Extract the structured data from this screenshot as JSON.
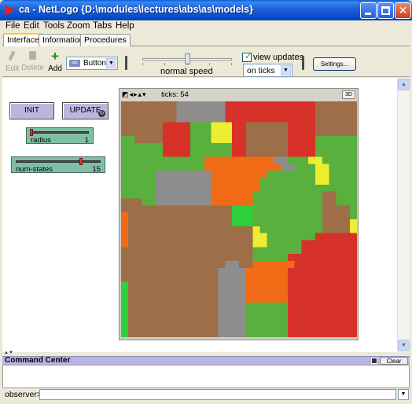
{
  "window": {
    "title": "ca - NetLogo {D:\\modules\\lectures\\abs\\as\\models}"
  },
  "menu": [
    "File",
    "Edit",
    "Tools",
    "Zoom",
    "Tabs",
    "Help"
  ],
  "tabs": [
    {
      "label": "Interface",
      "active": true
    },
    {
      "label": "Information",
      "active": false
    },
    {
      "label": "Procedures",
      "active": false
    }
  ],
  "toolbar": {
    "edit_label": "Edit",
    "delete_label": "Delete",
    "add_label": "Add",
    "widget_type": "Button",
    "speed_label": "normal speed",
    "speed_level": 0.5,
    "view_updates_label": "view updates",
    "view_updates_checked": true,
    "update_mode": "on ticks",
    "settings_label": "Settings..."
  },
  "widgets": {
    "init_button": "INIT",
    "update_button": "UPDATE",
    "radius_slider": {
      "name": "radius",
      "value": "1",
      "fraction": 0.0
    },
    "num_states_slider": {
      "name": "num-states",
      "value": "15",
      "fraction": 0.78
    }
  },
  "view": {
    "ticks_label": "ticks: 54",
    "btn_3d": "3D"
  },
  "command_center": {
    "title": "Command Center",
    "clear_label": "Clear",
    "prompt": "observer>"
  },
  "colors": {
    "brown": "#9D6E48",
    "gray": "#8D8D8D",
    "red": "#D73229",
    "green": "#59B03C",
    "orange": "#F16A15",
    "yellow": "#EDED31",
    "lime": "#2CD13B",
    "turquoise": "#1D9F78"
  },
  "world_grid": [
    "bbbbbbbbgggggggrrrrrrrrrrrrrbbbbbb",
    "bbbbbbbbgggggggrrrrrrrrrrrrrbbbbbb",
    "bbbbbbbbgggggggrrrrrrrrrrrrrbbbbbb",
    "bbbbbbrrrrGGGyyyrrbbbbbbrrrrbbbbbb",
    "bbbbbbrrrrGGGyyyrrbbbbbbrrrrbbbbbb",
    "GGbbbbrrrrGGGyyyrrbbbbbbrrrrGGGGGG",
    "GGGGGGrrrrGGGGGGrrbbbbbbrrrrGGGGGG",
    "GGGGGGrrrrGGGGGGrrbbbbbbrrrrGGGGGG",
    "GGGGGGGGGGGGooooooooooggGGGyyGGGGGG",
    "GGGGGGGGGGGGoooooooooooggGGGyyGGGGG",
    "GGGGGggggggggooooooooGGGGGGGyyGGGGG",
    "GGGGGggggggggoooooooGGGGGGGGyyGGGGG",
    "GGGGGggggggggoooooooGGGGGGGGGGGGGGG",
    "GGGGGggggggggooooooGGGGGGGGGGbbGGGG",
    "bbbGGggggggggooooooGGGGGGGGGGbbGGGG",
    "bbbbbbbbbbbbbbbbLLLGGGGGGGGGGbbbbGG",
    "obbbbbbbbbbbbbbbLLLGGGGGGGGGGbbbbGG",
    "obbbbbbbbbbbbbbbLLLGGGGGGGGGGbbbbyy",
    "obbbbbbbbbbbbbbbbbbyGGGGGGGGGbbbbyy",
    "obbbbbbbbbbbbbbbbbbyyGGGGGGGrrrrrrT",
    "obbbbbbbbbbbbbbbbbbyyGGGGGrrrrrrrrT",
    "bbbbbbbbbbbbbbbbbbbGGGGGGGrrrrrrrrr",
    "bbbbbbbbbbbbbbbbbbbGGGGGrrrrrrrrrrr",
    "bbbbbbbbbbbbbbbggbboooooorrrrrrrrrrLL",
    "bbbbbbbbbbbbbbggggoooooorrrrrrrrrrrLL",
    "bbbbbbbbbbbbbbggggoooooorrrrrrrrrrrLL",
    "LbbbbbbbbbbbbbggggoooooorrrrrrrrrrrLL",
    "LbbbbbbbbbbbbbggggoooooorrrrrrrrrrrLL",
    "LbbbbbbbbbbbbbggggoooooorrrrrrrrrrrLL",
    "LbbbbbbbbbbbbbggggGGGGGGrrrrrrrrrrrLL",
    "LbbbbbbbbbbbbbggggGGGGGGrrrrrrrrrrrLL",
    "LbbbbbbbbbbbbbggggGGGGGGrrrrrrrrrrrLL",
    "LbbbbbbbbbbbbbggggGGGGGGrrrrrrrrrrrLL",
    "LbbbbbbbbbbbbbggggGGGGGGrrrrrrrrrrrLL"
  ]
}
